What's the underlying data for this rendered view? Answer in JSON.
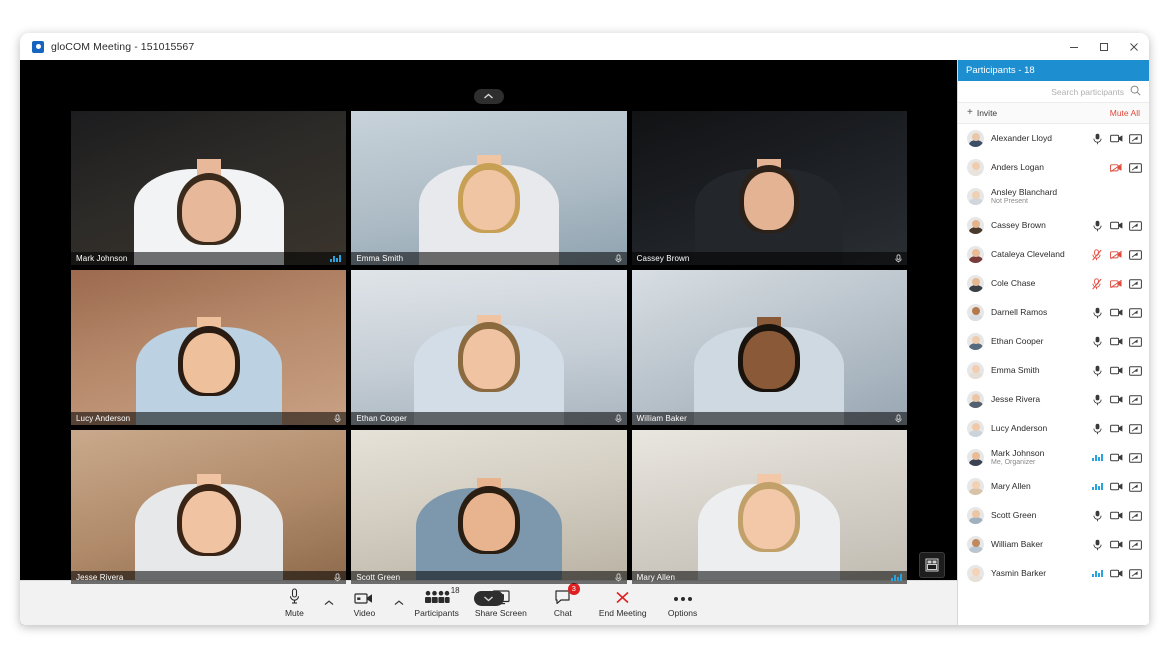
{
  "window": {
    "title": "gloCOM Meeting - 151015567",
    "logo_icon": "glocom-logo-icon",
    "minimize_label": "–",
    "maximize_label": "□",
    "close_label": "✕"
  },
  "stage": {
    "collapse_top_icon": "chevron-up-icon",
    "collapse_bottom_icon": "chevron-down-icon",
    "layout_switch_icon": "layout-view-icon",
    "tiles": [
      {
        "name": "Mark Johnson",
        "status": "speaking",
        "indicator": "audio-bars"
      },
      {
        "name": "Emma Smith",
        "status": "muted",
        "indicator": "mic-muted"
      },
      {
        "name": "Cassey Brown",
        "status": "muted",
        "indicator": "mic-muted"
      },
      {
        "name": "Lucy Anderson",
        "status": "muted",
        "indicator": "mic-muted"
      },
      {
        "name": "Ethan Cooper",
        "status": "muted",
        "indicator": "mic-muted"
      },
      {
        "name": "William Baker",
        "status": "muted",
        "indicator": "mic-muted"
      },
      {
        "name": "Jesse Rivera",
        "status": "muted",
        "indicator": "mic-muted"
      },
      {
        "name": "Scott Green",
        "status": "muted",
        "indicator": "mic-muted"
      },
      {
        "name": "Mary Allen",
        "status": "speaking",
        "indicator": "audio-bars"
      }
    ]
  },
  "toolbar": {
    "mute_label": "Mute",
    "mute_icon": "microphone-icon",
    "mute_caret_icon": "chevron-up-icon",
    "video_label": "Video",
    "video_icon": "camera-icon",
    "video_caret_icon": "chevron-up-icon",
    "participants_label": "Participants",
    "participants_icon": "people-icon",
    "participants_count": "18",
    "share_label": "Share Screen",
    "share_icon": "monitor-share-icon",
    "chat_label": "Chat",
    "chat_icon": "chat-bubble-icon",
    "chat_badge": "3",
    "end_label": "End Meeting",
    "end_icon": "close-x-icon",
    "options_label": "Options",
    "options_icon": "more-dots-icon"
  },
  "panel": {
    "header": "Participants - 18",
    "search_placeholder": "Search participants",
    "search_value": "",
    "search_icon": "search-icon",
    "invite_label": "Invite",
    "invite_icon": "plus-icon",
    "mute_all_label": "Mute All",
    "mic_icon": "microphone-icon",
    "mic_muted_icon": "microphone-muted-icon",
    "camera_icon": "camera-icon",
    "camera_muted_icon": "camera-muted-icon",
    "screen_icon": "screen-share-icon",
    "audio_bars_icon": "audio-level-icon",
    "participants": [
      {
        "name": "Alexander Lloyd",
        "sub": "",
        "mic": "on",
        "cam": "on",
        "screen": true
      },
      {
        "name": "Anders Logan",
        "sub": "",
        "mic": "none",
        "cam": "off",
        "screen": true
      },
      {
        "name": "Ansley Blanchard",
        "sub": "Not Present",
        "mic": "none",
        "cam": "none",
        "screen": false
      },
      {
        "name": "Cassey Brown",
        "sub": "",
        "mic": "on",
        "cam": "on",
        "screen": true
      },
      {
        "name": "Cataleya Cleveland",
        "sub": "",
        "mic": "off",
        "cam": "off",
        "screen": true
      },
      {
        "name": "Cole Chase",
        "sub": "",
        "mic": "off",
        "cam": "off",
        "screen": true
      },
      {
        "name": "Darnell Ramos",
        "sub": "",
        "mic": "on",
        "cam": "on",
        "screen": true
      },
      {
        "name": "Ethan Cooper",
        "sub": "",
        "mic": "on",
        "cam": "on",
        "screen": true
      },
      {
        "name": "Emma Smith",
        "sub": "",
        "mic": "on",
        "cam": "on",
        "screen": true
      },
      {
        "name": "Jesse Rivera",
        "sub": "",
        "mic": "on",
        "cam": "on",
        "screen": true
      },
      {
        "name": "Lucy Anderson",
        "sub": "",
        "mic": "on",
        "cam": "on",
        "screen": true
      },
      {
        "name": "Mark Johnson",
        "sub": "Me, Organizer",
        "mic": "bars",
        "cam": "on",
        "screen": true
      },
      {
        "name": "Mary Allen",
        "sub": "",
        "mic": "bars",
        "cam": "on",
        "screen": true
      },
      {
        "name": "Scott Green",
        "sub": "",
        "mic": "on",
        "cam": "on",
        "screen": true
      },
      {
        "name": "William Baker",
        "sub": "",
        "mic": "on",
        "cam": "on",
        "screen": true
      },
      {
        "name": "Yasmin Barker",
        "sub": "",
        "mic": "bars",
        "cam": "on",
        "screen": true
      }
    ]
  },
  "colors": {
    "accent": "#1d8fd1",
    "danger": "#e04a3c",
    "badge": "#e02020",
    "stage_bg": "#000000",
    "toolbar_bg": "#f2f2f2"
  }
}
